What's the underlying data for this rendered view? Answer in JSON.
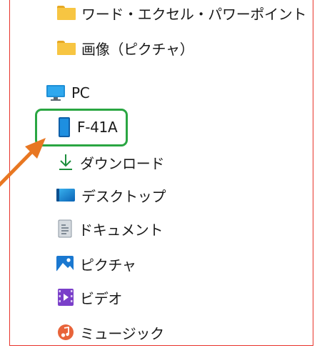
{
  "sidebar": {
    "items": [
      {
        "label": "ワード・エクセル・パワーポイント",
        "icon": "folder-icon"
      },
      {
        "label": "画像（ピクチャ）",
        "icon": "folder-icon"
      },
      {
        "label": "PC",
        "icon": "monitor-icon"
      },
      {
        "label": "F-41A",
        "icon": "phone-device-icon"
      },
      {
        "label": "ダウンロード",
        "icon": "download-icon"
      },
      {
        "label": "デスクトップ",
        "icon": "desktop-icon"
      },
      {
        "label": "ドキュメント",
        "icon": "document-icon"
      },
      {
        "label": "ピクチャ",
        "icon": "picture-icon"
      },
      {
        "label": "ビデオ",
        "icon": "video-icon"
      },
      {
        "label": "ミュージック",
        "icon": "music-icon"
      }
    ]
  },
  "annotation": {
    "highlight_color": "#2aa642",
    "arrow_color": "#e87722",
    "frame_color": "#e8332a"
  }
}
